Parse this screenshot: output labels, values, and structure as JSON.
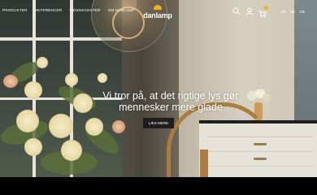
{
  "nav": {
    "items": [
      "PRODUKTER",
      "REFERENCER",
      "VIDENSCENTER",
      "OM DANLAMP"
    ]
  },
  "brand": {
    "logo_text": "danlamp",
    "accent_color": "#f2b21c"
  },
  "header_icons": [
    "search-icon",
    "user-icon",
    "cart-icon"
  ],
  "languages": [
    "DK",
    "SE",
    "GB"
  ],
  "hero": {
    "headline_line1": "Vi tror på, at det rigtige lys gør",
    "headline_line2": "mennesker mere glade",
    "cta_label": "LÆS MERE"
  }
}
